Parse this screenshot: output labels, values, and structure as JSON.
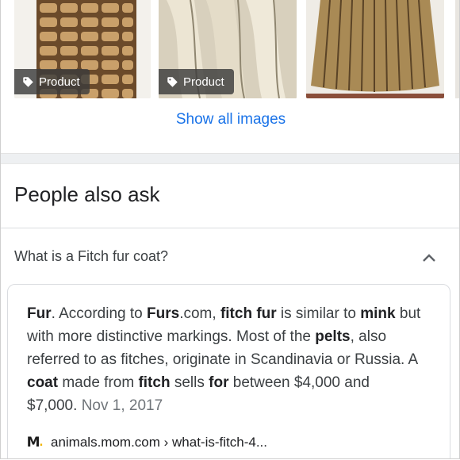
{
  "images": {
    "items": [
      {
        "badge": "Product",
        "icon": "tag-icon"
      },
      {
        "badge": "Product",
        "icon": "tag-icon"
      },
      {
        "badge": "",
        "icon": ""
      }
    ],
    "show_all_label": "Show all images"
  },
  "paa": {
    "title": "People also ask",
    "question": "What is a Fitch fur coat?",
    "expanded_icon": "chevron-up-icon",
    "answer": {
      "segments": [
        {
          "text": "Fur",
          "bold": true
        },
        {
          "text": ". According to ",
          "bold": false
        },
        {
          "text": "Furs",
          "bold": true
        },
        {
          "text": ".com, ",
          "bold": false
        },
        {
          "text": "fitch fur",
          "bold": true
        },
        {
          "text": " is similar to ",
          "bold": false
        },
        {
          "text": "mink",
          "bold": true
        },
        {
          "text": " but with more distinctive markings. Most of the ",
          "bold": false
        },
        {
          "text": "pelts",
          "bold": true
        },
        {
          "text": ", also referred to as fitches, originate in Scandinavia or Russia. A ",
          "bold": false
        },
        {
          "text": "coat",
          "bold": true
        },
        {
          "text": " made from ",
          "bold": false
        },
        {
          "text": "fitch",
          "bold": true
        },
        {
          "text": " sells ",
          "bold": false
        },
        {
          "text": "for",
          "bold": true
        },
        {
          "text": " between $4,000 and $7,000.",
          "bold": false
        }
      ],
      "date": "Nov 1, 2017"
    },
    "source": {
      "favicon_letter": "M",
      "favicon_dot": ".",
      "text": "animals.mom.com › what-is-fitch-4..."
    }
  },
  "colors": {
    "link": "#1a73e8",
    "text": "#202124",
    "secondary": "#70757a"
  }
}
